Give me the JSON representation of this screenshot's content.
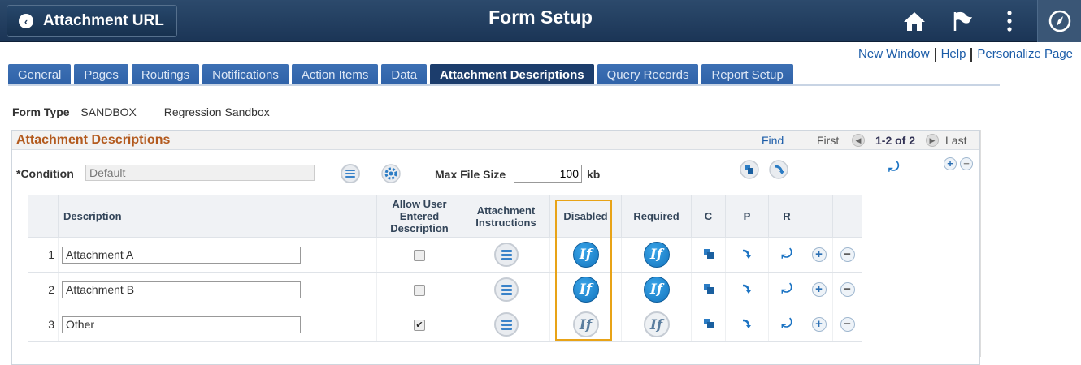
{
  "header": {
    "back_label": "Attachment URL",
    "title": "Form Setup",
    "icons": [
      "home-icon",
      "flag-icon",
      "kebab-menu-icon",
      "navbar-compass-icon"
    ]
  },
  "links": {
    "new_window": "New Window",
    "help": "Help",
    "personalize": "Personalize Page"
  },
  "tabs": [
    {
      "label": "General"
    },
    {
      "label": "Pages"
    },
    {
      "label": "Routings"
    },
    {
      "label": "Notifications"
    },
    {
      "label": "Action Items"
    },
    {
      "label": "Data"
    },
    {
      "label": "Attachment Descriptions",
      "active": true
    },
    {
      "label": "Query Records"
    },
    {
      "label": "Report Setup"
    }
  ],
  "form_type": {
    "label": "Form Type",
    "code": "SANDBOX",
    "name": "Regression Sandbox"
  },
  "section": {
    "title": "Attachment Descriptions",
    "find": "Find",
    "first": "First",
    "count": "1-2 of 2",
    "last": "Last"
  },
  "condition": {
    "label": "*Condition",
    "value": "Default"
  },
  "max_file": {
    "label": "Max File Size",
    "value": "100",
    "unit": "kb"
  },
  "grid": {
    "headers": {
      "description": "Description",
      "allow": "Allow User Entered Description",
      "instructions": "Attachment Instructions",
      "disabled": "Disabled",
      "required": "Required",
      "c": "C",
      "p": "P",
      "r": "R"
    },
    "rows": [
      {
        "num": "1",
        "description": "Attachment A",
        "allow": false,
        "disabled_active": true,
        "required_active": true
      },
      {
        "num": "2",
        "description": "Attachment B",
        "allow": false,
        "disabled_active": true,
        "required_active": true
      },
      {
        "num": "3",
        "description": "Other",
        "allow": true,
        "disabled_active": false,
        "required_active": false
      }
    ]
  },
  "colors": {
    "header_bg": "#1b3556",
    "tab_bg": "#2f62a8",
    "tab_active": "#1c3d6c",
    "section_title": "#b35a1e",
    "highlight": "#e8a317"
  }
}
